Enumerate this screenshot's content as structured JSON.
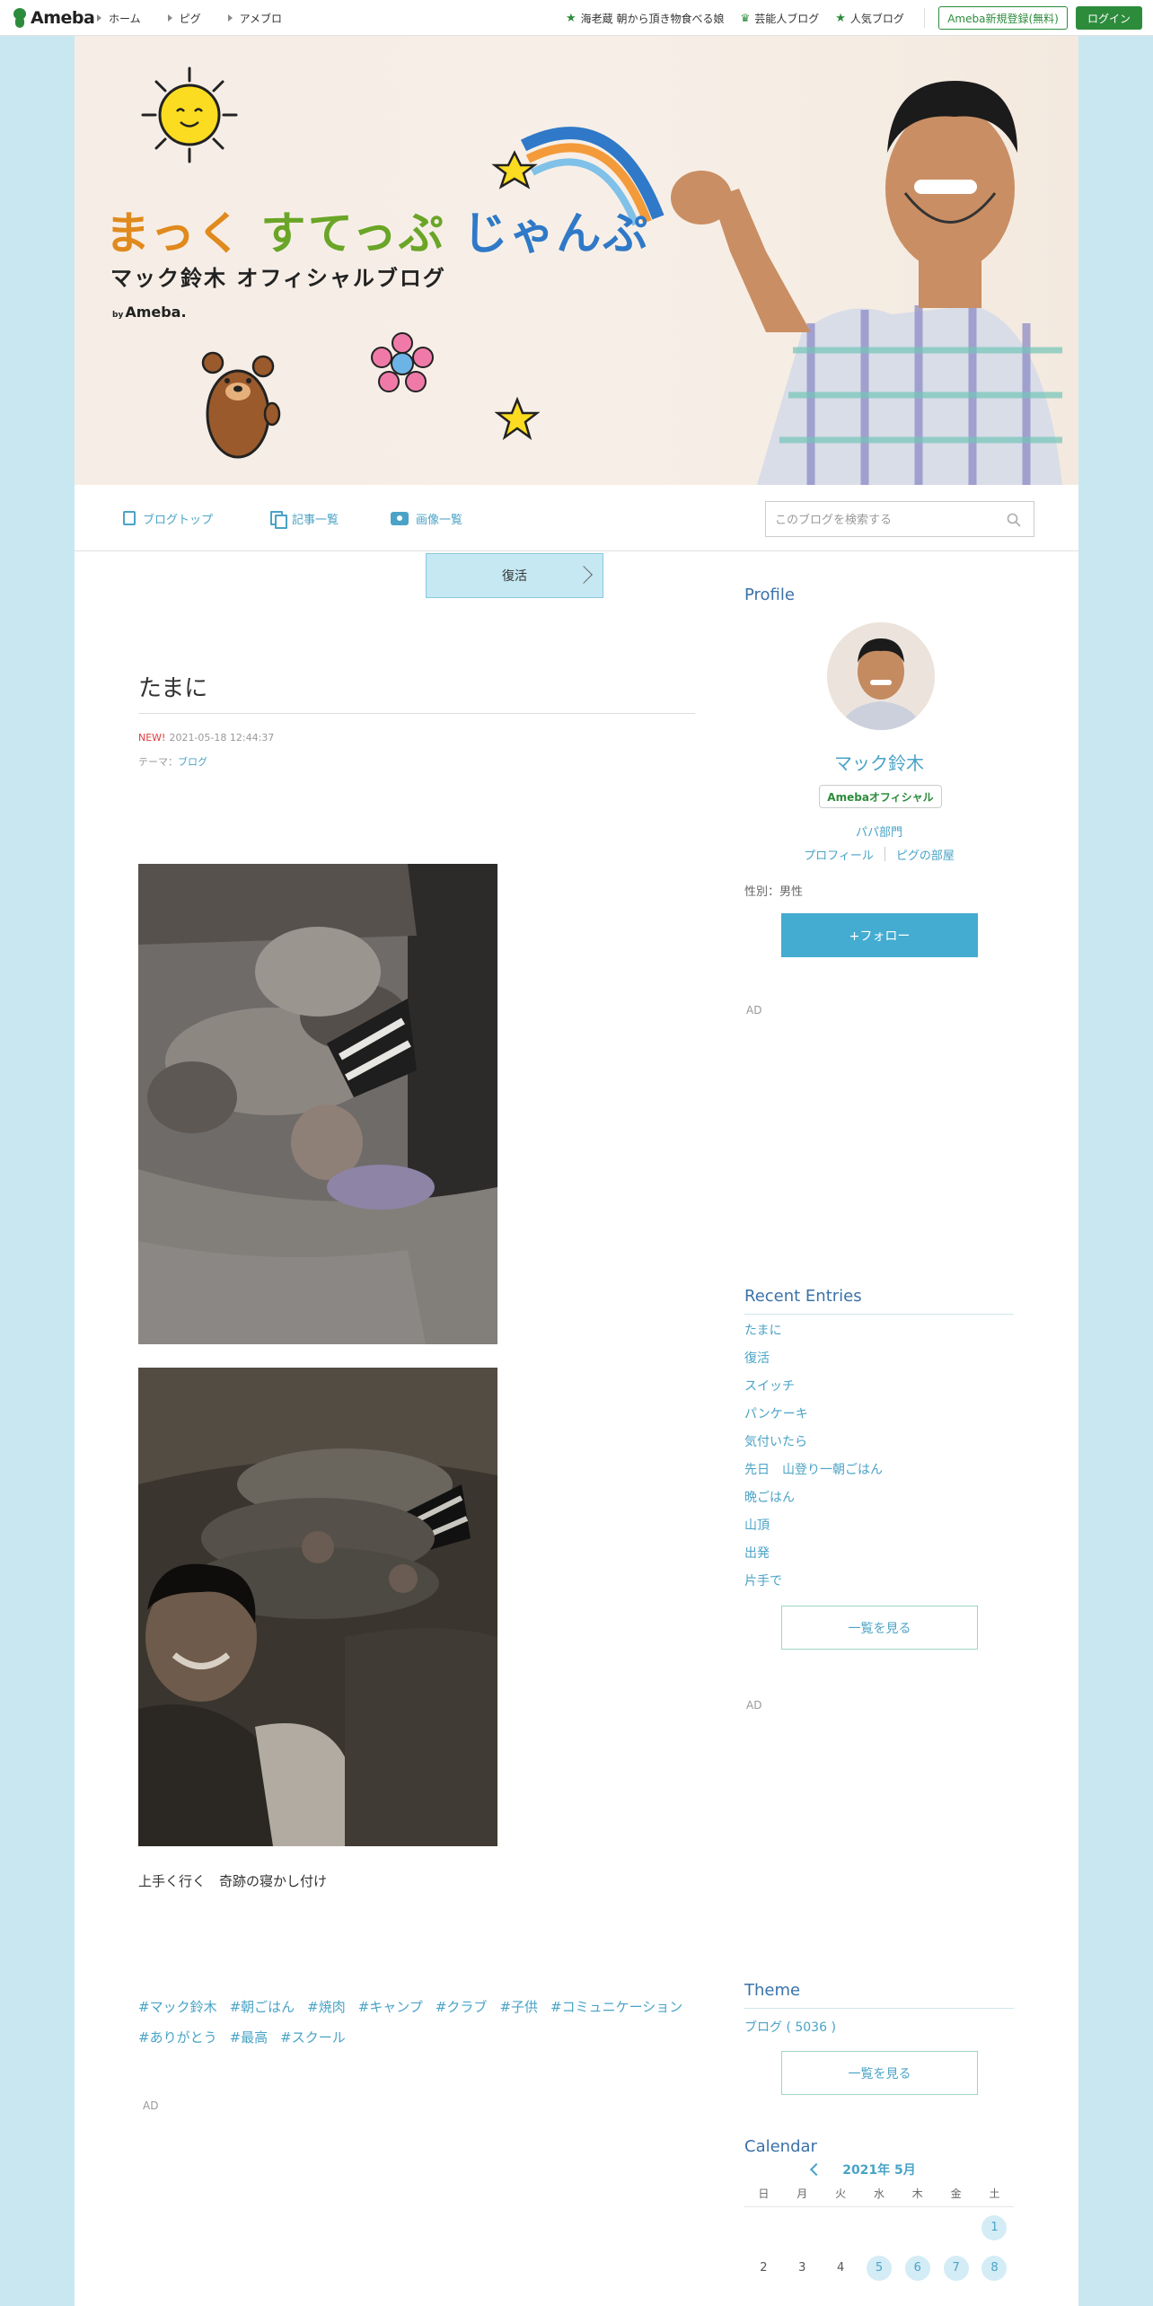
{
  "topbar": {
    "logo_text": "Ameba",
    "nav": [
      "ホーム",
      "ピグ",
      "アメブロ"
    ],
    "links": [
      {
        "icon": "star-icon",
        "label": "海老蔵 朝から頂き物食べる娘"
      },
      {
        "icon": "crown-icon",
        "label": "芸能人ブログ"
      },
      {
        "icon": "star-icon",
        "label": "人気ブログ"
      }
    ],
    "register_label": "Ameba新規登録(無料)",
    "login_label": "ログイン"
  },
  "header": {
    "title_line1_a": "まっく",
    "title_line1_b": "すてっぷ",
    "title_line1_c": "じゃんぷ",
    "title_line2": "マック鈴木 オフィシャルブログ",
    "title_line3_by": "by",
    "title_line3": "Ameba."
  },
  "blognav": {
    "items": [
      "ブログトップ",
      "記事一覧",
      "画像一覧"
    ],
    "search_placeholder": "このブログを検索する"
  },
  "entry": {
    "prev_button": "復活",
    "title": "たまに",
    "new_label": "NEW!",
    "datetime": "2021-05-18 12:44:37",
    "theme_prefix": "テーマ：",
    "theme": "ブログ",
    "text": "上手く行く　奇跡の寝かし付け",
    "hashtags": [
      "#マック鈴木",
      "#朝ごはん",
      "#焼肉",
      "#キャンプ",
      "#クラブ",
      "#子供",
      "#コミュニケーション",
      "#ありがとう",
      "#最高",
      "#スクール"
    ],
    "ad_label": "AD"
  },
  "sidebar": {
    "profile_heading": "Profile",
    "name": "マック鈴木",
    "badge": "Amebaオフィシャル",
    "category": "パパ部門",
    "link_profile": "プロフィール",
    "link_pig": "ピグの部屋",
    "gender": "性別：男性",
    "follow_label": "+フォロー",
    "ad_label": "AD",
    "recent_heading": "Recent Entries",
    "recent": [
      "たまに",
      "復活",
      "スイッチ",
      "パンケーキ",
      "気付いたら",
      "先日　山登り一朝ごはん",
      "晩ごはん",
      "山頂",
      "出発",
      "片手で"
    ],
    "see_all": "一覧を見る",
    "theme_heading": "Theme",
    "theme_item": "ブログ ( 5036 )",
    "calendar_heading": "Calendar",
    "calendar_month": "2021年 5月",
    "weekdays": [
      "日",
      "月",
      "火",
      "水",
      "木",
      "金",
      "土"
    ],
    "calendar_rows": [
      [
        "",
        "",
        "",
        "",
        "",
        "",
        "1"
      ],
      [
        "2",
        "3",
        "4",
        "5",
        "6",
        "7",
        "8"
      ]
    ],
    "linked_days": [
      "1",
      "5",
      "6",
      "7",
      "8"
    ]
  },
  "colors": {
    "accent": "#4aa3c6",
    "brand_green": "#2d8c3c",
    "background": "#c9e7f0",
    "follow_button": "#44acd1"
  }
}
